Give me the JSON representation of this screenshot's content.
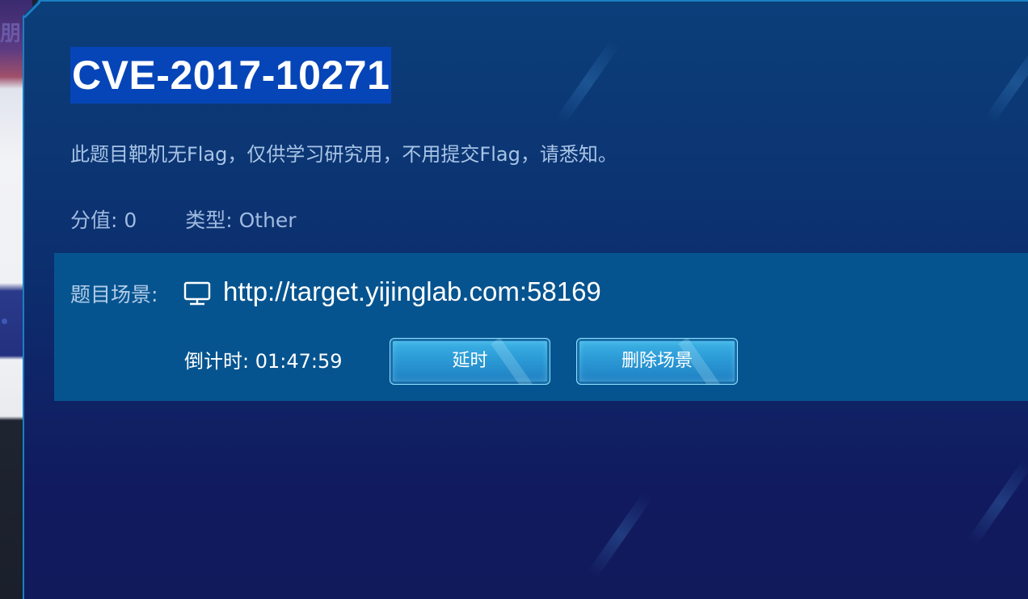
{
  "background": {
    "left_glyph": "朋"
  },
  "challenge": {
    "title": "CVE-2017-10271",
    "notice": "此题目靶机无Flag，仅供学习研究用，不用提交Flag，请悉知。",
    "score_label": "分值:",
    "score_value": "0",
    "type_label": "类型:",
    "type_value": "Other"
  },
  "scene": {
    "label": "题目场景:",
    "icon": "monitor-icon",
    "url": "http://target.yijinglab.com:58169",
    "countdown_label": "倒计时:",
    "countdown_value": "01:47:59",
    "extend_button": "延时",
    "delete_button": "删除场景"
  },
  "colors": {
    "title_highlight": "#0645b8",
    "panel": "#06548f",
    "button": "#2b9ad6"
  }
}
